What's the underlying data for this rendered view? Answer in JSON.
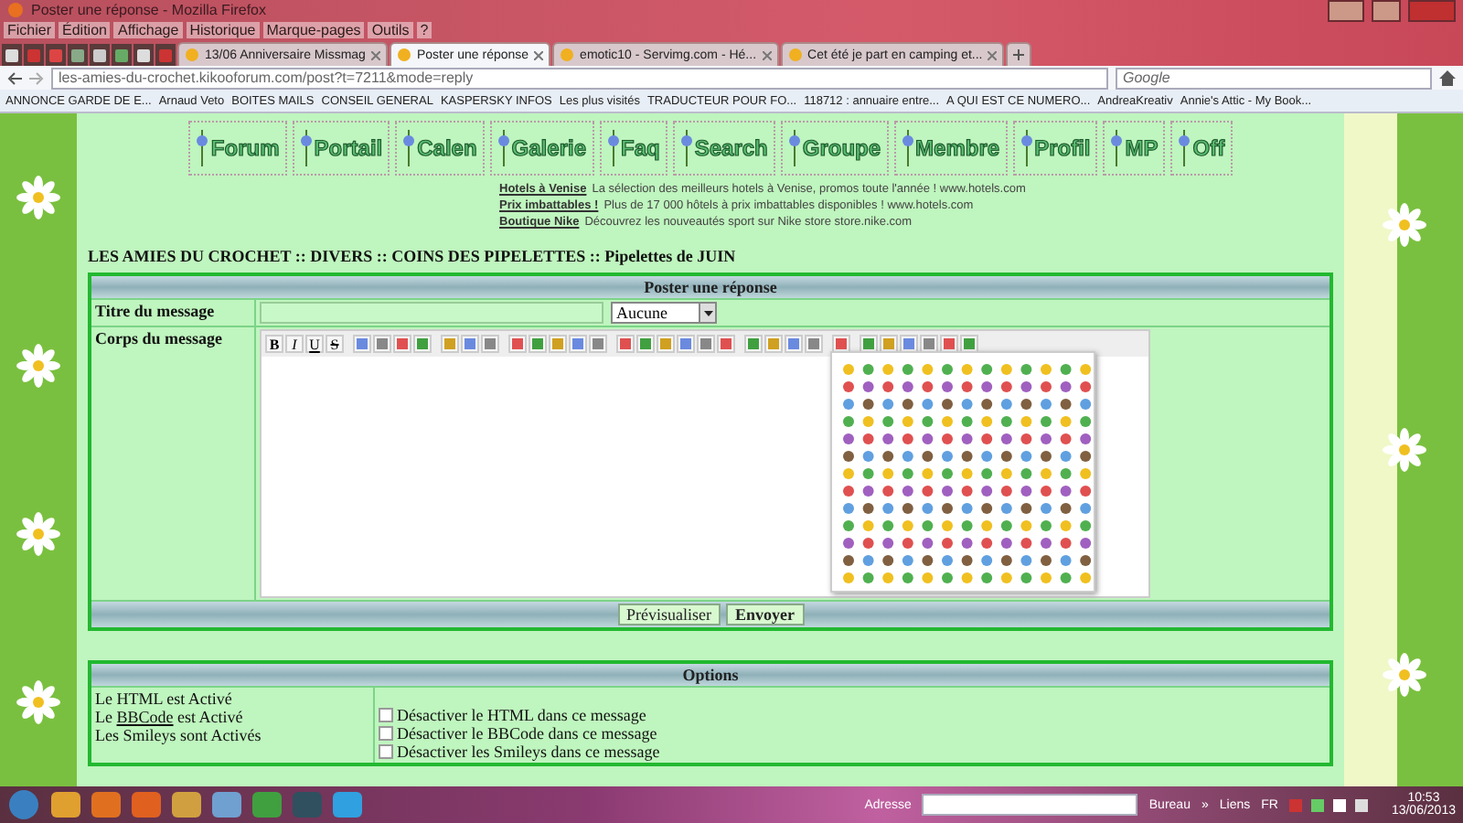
{
  "window": {
    "title": "Poster une réponse - Mozilla Firefox"
  },
  "menu": [
    "Fichier",
    "Édition",
    "Affichage",
    "Historique",
    "Marque-pages",
    "Outils",
    "?"
  ],
  "tabs": [
    {
      "label": "13/06 Anniversaire Missmag",
      "selected": false
    },
    {
      "label": "Poster une réponse",
      "selected": true
    },
    {
      "label": "emotic10 - Servimg.com - Hé...",
      "selected": false
    },
    {
      "label": "Cet été je part en camping et...",
      "selected": false
    }
  ],
  "address": {
    "value": "les-amies-du-crochet.kikooforum.com/post?t=7211&mode=reply"
  },
  "search": {
    "placeholder": "Google"
  },
  "bookmarks": [
    "ANNONCE GARDE DE E...",
    "Arnaud Veto",
    "BOITES MAILS",
    "CONSEIL GENERAL",
    "KASPERSKY INFOS",
    "Les plus visités",
    "TRADUCTEUR POUR FO...",
    "118712 : annuaire entre...",
    "A QUI EST CE NUMERO...",
    "AndreaKreativ",
    "Annie's Attic - My Book..."
  ],
  "forum_nav": [
    "Forum",
    "Portail",
    "Calen",
    "Galerie",
    "Faq",
    "Search",
    "Groupe",
    "Membre",
    "Profil",
    "MP",
    "Off"
  ],
  "ads": [
    {
      "link": "Hotels à Venise",
      "text": "La sélection des meilleurs hotels à Venise, promos toute l'année ! www.hotels.com"
    },
    {
      "link": "Prix imbattables !",
      "text": "Plus de 17 000 hôtels à prix imbattables disponibles ! www.hotels.com"
    },
    {
      "link": "Boutique Nike",
      "text": "Découvrez les nouveautés sport sur Nike store store.nike.com"
    }
  ],
  "breadcrumb": "LES AMIES DU CROCHET  :: DIVERS :: COINS DES PIPELETTES :: Pipelettes de JUIN",
  "form": {
    "title": "Poster une réponse",
    "subject_label": "Titre du message",
    "icon_select": "Aucune",
    "body_label": "Corps du message",
    "format_buttons": [
      "B",
      "I",
      "U",
      "S"
    ],
    "buttons": [
      {
        "label": "Prévisualiser",
        "kind": "secondary"
      },
      {
        "label": "Envoyer",
        "kind": "primary"
      }
    ]
  },
  "options": {
    "title": "Options",
    "status": [
      {
        "text": "Le HTML est Activé"
      },
      {
        "before": "Le ",
        "link": "BBCode",
        "after": " est Activé"
      },
      {
        "text": "Les Smileys sont Activés"
      }
    ],
    "checkboxes": [
      {
        "label": "Désactiver le HTML dans ce message",
        "checked": false
      },
      {
        "label": "Désactiver le BBCode dans ce message",
        "checked": false
      },
      {
        "label": "Désactiver les Smileys dans ce message",
        "checked": false
      }
    ]
  },
  "taskbar": {
    "address_label": "Adresse",
    "toolbars": [
      "Bureau",
      "»",
      "Liens"
    ],
    "language": "FR",
    "time": "10:53",
    "date": "13/06/2013"
  }
}
